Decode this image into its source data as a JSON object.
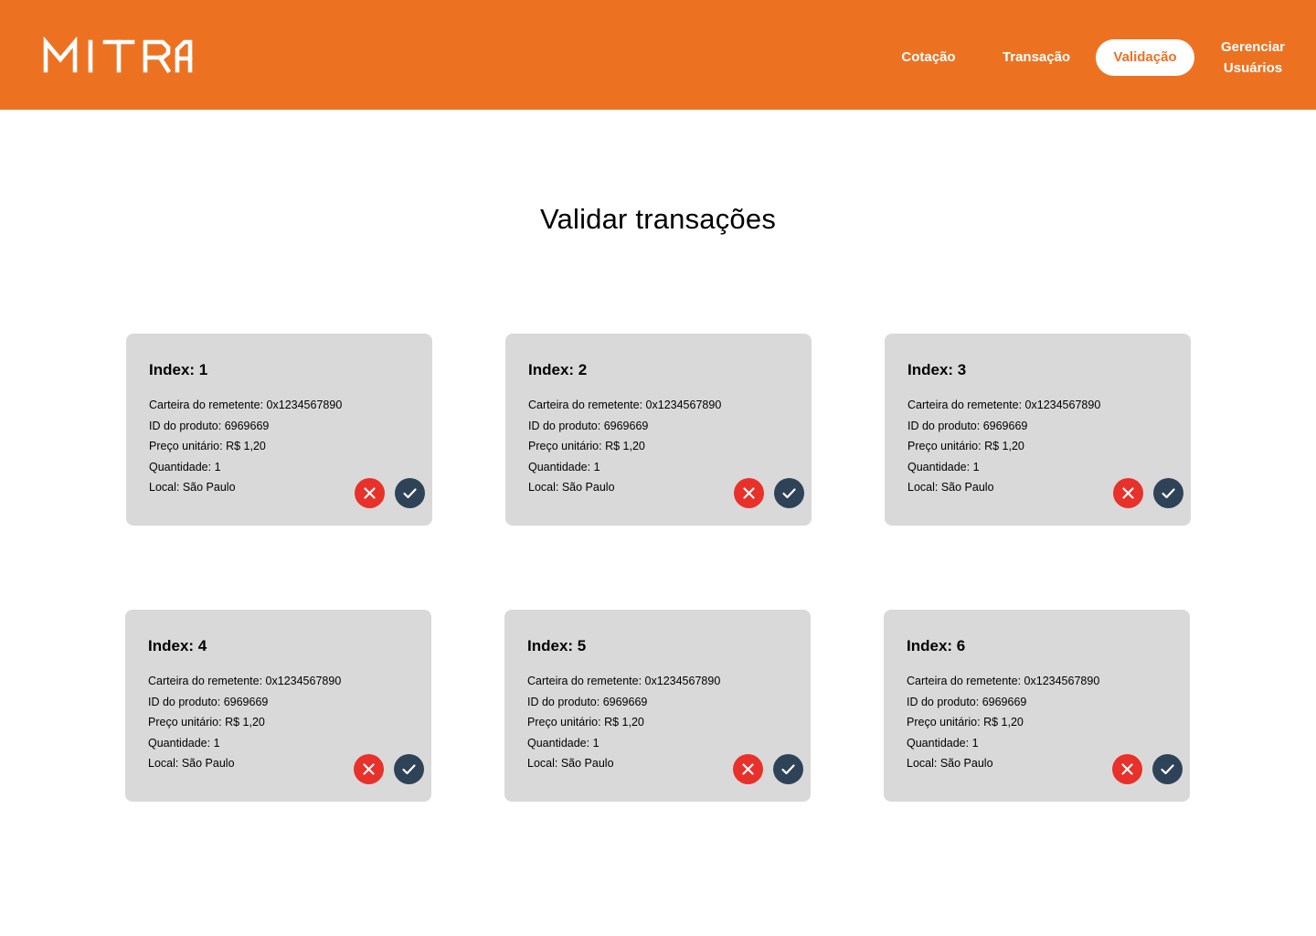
{
  "header": {
    "brand": "MITRA",
    "brand_color": "#EC7222",
    "nav": [
      {
        "label": "Cotação",
        "active": false
      },
      {
        "label": "Transação",
        "active": false
      },
      {
        "label": "Validação",
        "active": true
      },
      {
        "label_line1": "Gerenciar",
        "label_line2": "Usuários",
        "active": false
      }
    ]
  },
  "main": {
    "title": "Validar transações",
    "transactions": [
      {
        "title": "Index: 1",
        "wallet_label": "Carteira do remetente:",
        "wallet": "0x1234567890",
        "product_label": "ID do produto:",
        "product": "6969669",
        "price_label": "Preço unitário:",
        "price": "R$ 1,20",
        "qty_label": "Quantidade:",
        "qty": "1",
        "location_label": "Local:",
        "location": "São Paulo",
        "reject_icon": "close-icon",
        "approve_icon": "check-icon"
      },
      {
        "title": "Index: 2",
        "wallet_label": "Carteira do remetente:",
        "wallet": "0x1234567890",
        "product_label": "ID do produto:",
        "product": "6969669",
        "price_label": "Preço unitário:",
        "price": "R$ 1,20",
        "qty_label": "Quantidade:",
        "qty": "1",
        "location_label": "Local:",
        "location": "São Paulo",
        "reject_icon": "close-icon",
        "approve_icon": "check-icon"
      },
      {
        "title": "Index: 3",
        "wallet_label": "Carteira do remetente:",
        "wallet": "0x1234567890",
        "product_label": "ID do produto:",
        "product": "6969669",
        "price_label": "Preço unitário:",
        "price": "R$ 1,20",
        "qty_label": "Quantidade:",
        "qty": "1",
        "location_label": "Local:",
        "location": "São Paulo",
        "reject_icon": "close-icon",
        "approve_icon": "check-icon"
      },
      {
        "title": "Index: 4",
        "wallet_label": "Carteira do remetente:",
        "wallet": "0x1234567890",
        "product_label": "ID do produto:",
        "product": "6969669",
        "price_label": "Preço unitário:",
        "price": "R$ 1,20",
        "qty_label": "Quantidade:",
        "qty": "1",
        "location_label": "Local:",
        "location": "São Paulo",
        "reject_icon": "close-icon",
        "approve_icon": "check-icon"
      },
      {
        "title": "Index: 5",
        "wallet_label": "Carteira do remetente:",
        "wallet": "0x1234567890",
        "product_label": "ID do produto:",
        "product": "6969669",
        "price_label": "Preço unitário:",
        "price": "R$ 1,20",
        "qty_label": "Quantidade:",
        "qty": "1",
        "location_label": "Local:",
        "location": "São Paulo",
        "reject_icon": "close-icon",
        "approve_icon": "check-icon"
      },
      {
        "title": "Index: 6",
        "wallet_label": "Carteira do remetente:",
        "wallet": "0x1234567890",
        "product_label": "ID do produto:",
        "product": "6969669",
        "price_label": "Preço unitário:",
        "price": "R$ 1,20",
        "qty_label": "Quantidade:",
        "qty": "1",
        "location_label": "Local:",
        "location": "São Paulo",
        "reject_icon": "close-icon",
        "approve_icon": "check-icon"
      }
    ]
  },
  "colors": {
    "card_bg": "#D9D9D9",
    "reject": "#E8312A",
    "approve": "#2E4358"
  }
}
